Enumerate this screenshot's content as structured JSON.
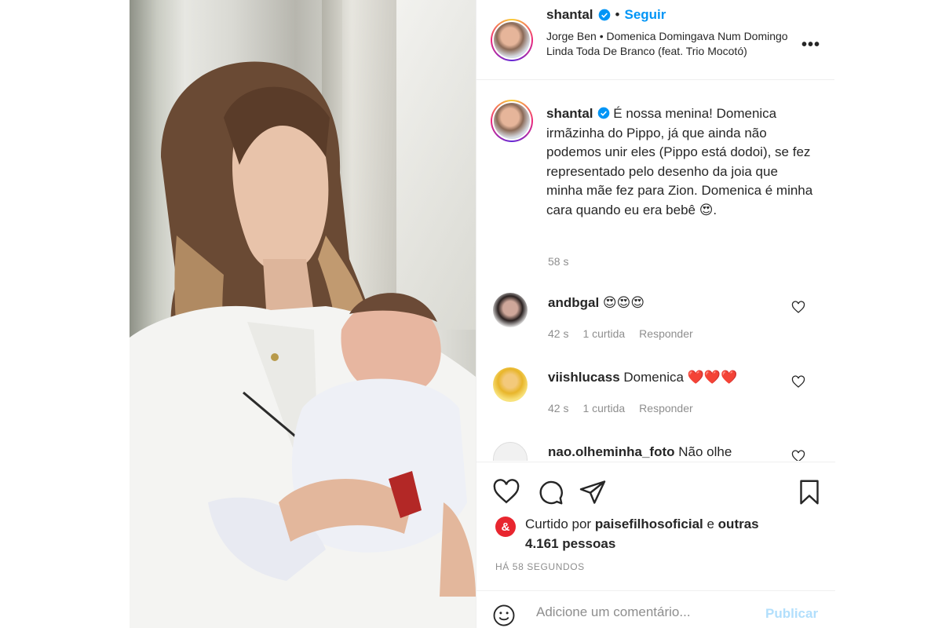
{
  "post": {
    "username": "shantal",
    "separator": "•",
    "follow_label": "Seguir",
    "song": "Jorge Ben • Domenica Domingava Num Domingo Linda Toda De Branco (feat. Trio Mocotó)",
    "more_label": "•••"
  },
  "caption": {
    "username": "shantal",
    "text": " É nossa menina! Domenica irmãzinha do Pippo, já que ainda não podemos unir eles (Pippo está dodoi), se fez representado pelo desenho da joia que minha mãe fez para Zion. Domenica é minha cara quando eu era bebê 😍.",
    "time": "58 s"
  },
  "comments": [
    {
      "username": "andbgal",
      "text": " 😍😍😍",
      "time": "42 s",
      "likes": "1 curtida",
      "reply": "Responder"
    },
    {
      "username": "viishlucass",
      "text": " Domenica ❤️❤️❤️",
      "time": "42 s",
      "likes": "1 curtida",
      "reply": "Responder"
    },
    {
      "username": "nao.olheminha_foto",
      "text": " Não olhe"
    }
  ],
  "likes": {
    "prefix": "Curtido por ",
    "user": "paisefilhosoficial",
    "middle": " e ",
    "others": "outras 4.161 pessoas"
  },
  "timestamp": "Há 58 segundos",
  "comment_box": {
    "placeholder": "Adicione um comentário...",
    "publish_label": "Publicar"
  },
  "colors": {
    "accent": "#0095f6",
    "publish_disabled": "#b2dffc",
    "muted": "#8e8e8e",
    "text": "#262626"
  }
}
